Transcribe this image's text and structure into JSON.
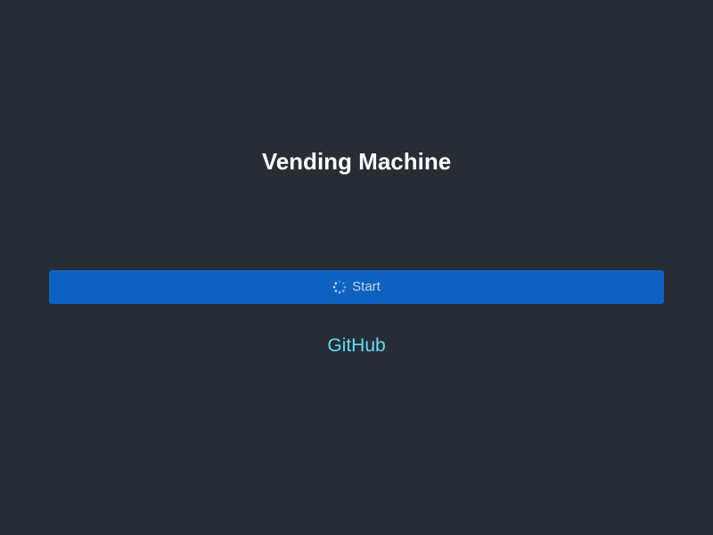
{
  "header": {
    "title": "Vending Machine"
  },
  "start_button": {
    "label": "Start",
    "icon": "loading-spinner-icon"
  },
  "link": {
    "label": "GitHub"
  },
  "colors": {
    "background": "#282c34",
    "button": "#0d61c0",
    "link": "#61dafb",
    "title": "#ffffff"
  }
}
